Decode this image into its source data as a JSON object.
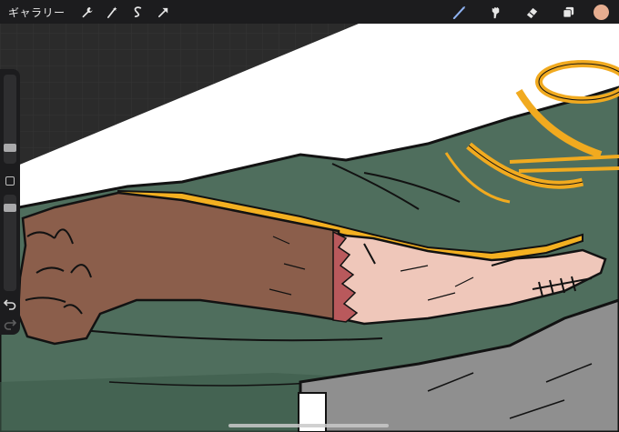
{
  "topbar": {
    "gallery_label": "ギャラリー",
    "left_tools": [
      "wrench-icon",
      "magic-wand-icon",
      "selection-icon",
      "transform-arrow-icon"
    ],
    "right_tools": [
      "brush-icon",
      "smudge-icon",
      "eraser-icon",
      "layers-icon"
    ],
    "active_tool": "brush-icon",
    "active_color": "#8fb3f2",
    "current_color": "#e6ad90"
  },
  "sidebar": {
    "size_slider_value": 0.15,
    "opacity_slider_value": 0.0,
    "icons": [
      "modify-square-icon",
      "undo-icon",
      "redo-icon"
    ]
  },
  "artwork": {
    "colors": {
      "background": "#2b2b2b",
      "paper": "#ffffff",
      "sleeve_green": "#4f6e5d",
      "sleeve_shadow": "#3e5b4b",
      "sleeve_trim": "#f3b021",
      "cord_gold": "#f1aa1f",
      "arm_brown": "#8b5e4b",
      "arm_pink": "#efc7ba",
      "scar_red": "#b9595c",
      "pants_gray": "#8f8f8f",
      "lineart": "#121212"
    }
  }
}
